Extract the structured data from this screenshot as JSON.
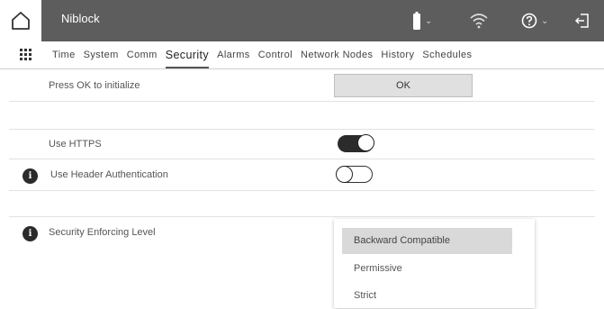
{
  "header": {
    "app_title": "Niblock",
    "icons": [
      "home-icon",
      "battery-icon",
      "wifi-icon",
      "help-icon",
      "logout-icon"
    ]
  },
  "nav": {
    "tabs": [
      {
        "label": "Time"
      },
      {
        "label": "System"
      },
      {
        "label": "Comm"
      },
      {
        "label": "Security",
        "active": true
      },
      {
        "label": "Alarms"
      },
      {
        "label": "Control"
      },
      {
        "label": "Network Nodes"
      },
      {
        "label": "History"
      },
      {
        "label": "Schedules"
      }
    ]
  },
  "security": {
    "initialize_label": "Press OK to initialize",
    "ok_label": "OK",
    "https_label": "Use HTTPS",
    "https_enabled": true,
    "header_auth_label": "Use Header Authentication",
    "header_auth_enabled": false,
    "enforcing_label": "Security Enforcing Level",
    "enforcing_options": [
      "Backward Compatible",
      "Permissive",
      "Strict"
    ],
    "enforcing_selected": "Backward Compatible"
  },
  "colors": {
    "topbar": "#5d5d5d",
    "toggle_on": "#2b2b2b",
    "button": "#e0e0e0",
    "selected_option": "#d9d9d9"
  }
}
